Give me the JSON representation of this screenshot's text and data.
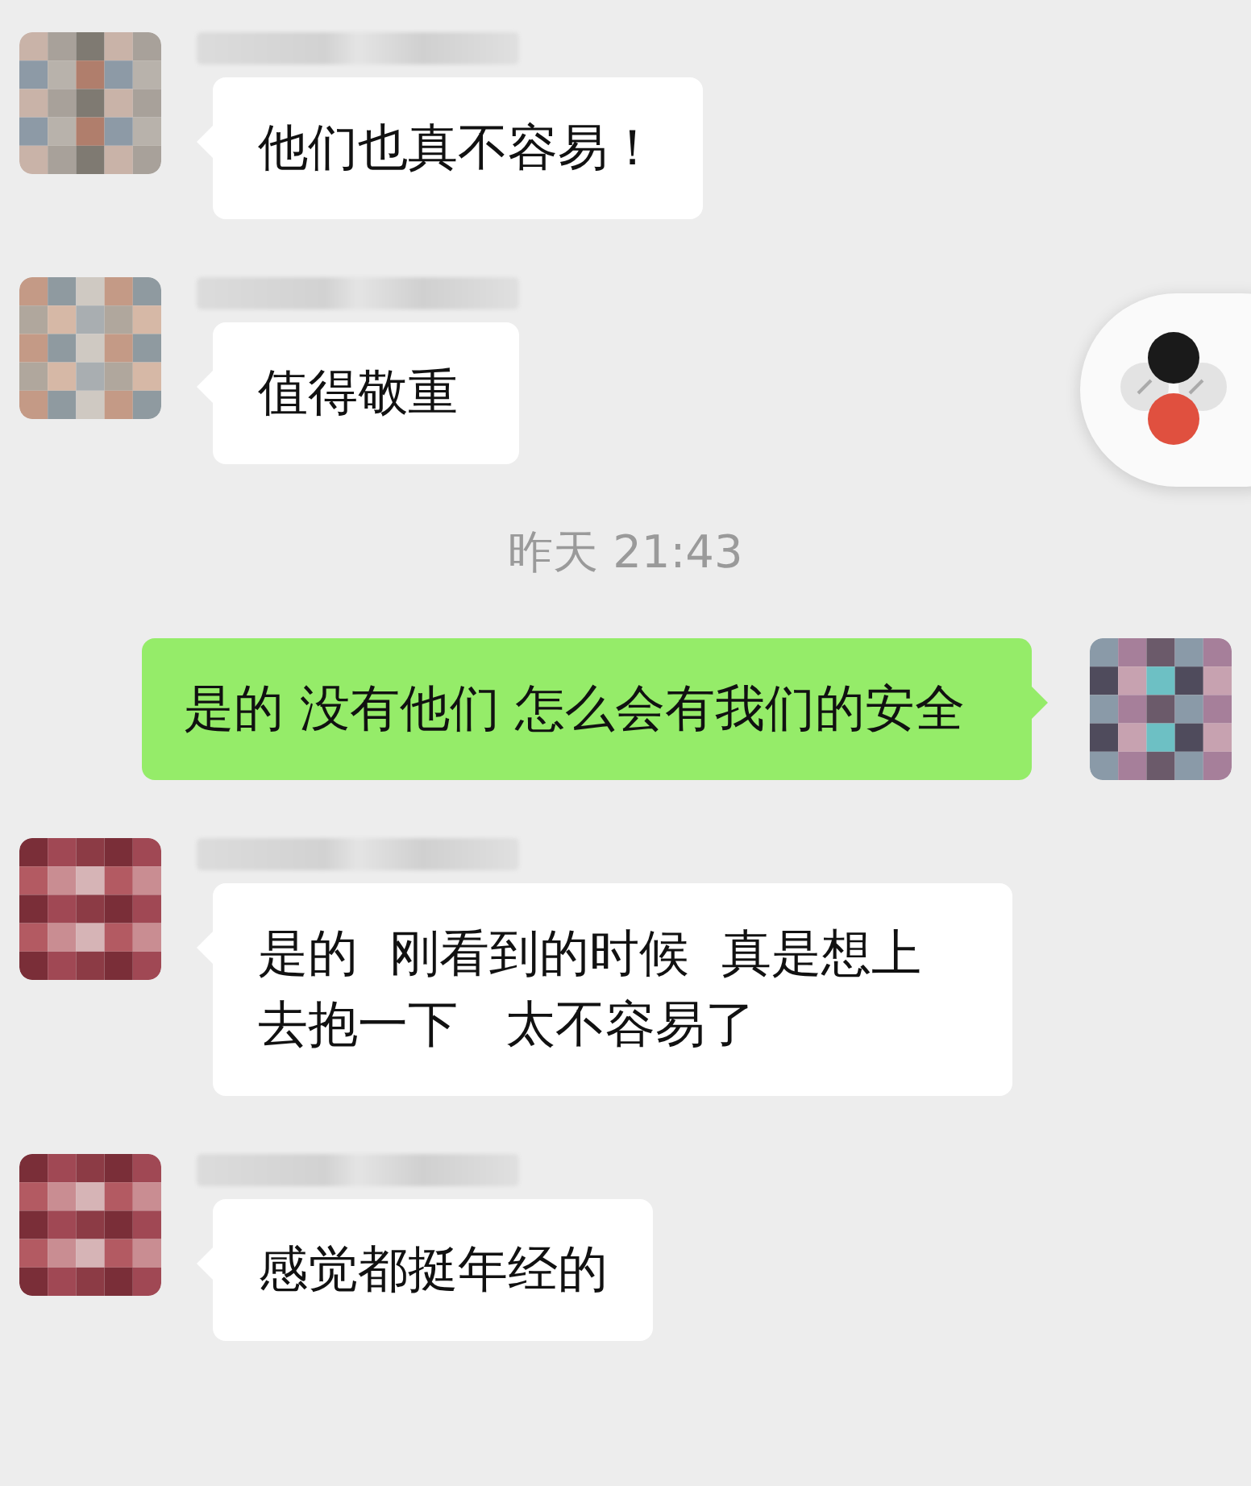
{
  "messages": [
    {
      "kind": "incoming",
      "text": "他们也真不容易！"
    },
    {
      "kind": "incoming",
      "text": "值得敬重"
    },
    {
      "kind": "time",
      "text": "昨天 21:43"
    },
    {
      "kind": "outgoing",
      "text": "是的 没有他们 怎么会有我们的安全"
    },
    {
      "kind": "incoming",
      "text": "是的  刚看到的时候  真是想上去抱一下   太不容易了"
    },
    {
      "kind": "incoming",
      "text": "感觉都挺年经的"
    }
  ]
}
